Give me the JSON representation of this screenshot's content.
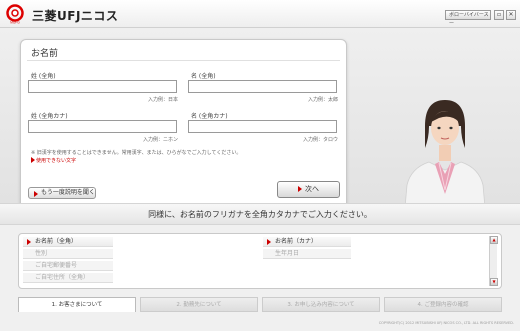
{
  "header": {
    "logo_text": "三菱UFJニコス",
    "lang_button": "ボローバイバースー",
    "win_buttons": [
      "▫",
      "✕"
    ]
  },
  "form": {
    "title": "お名前",
    "fields": [
      {
        "label": "姓 (全角)",
        "example": "入力例：日本"
      },
      {
        "label": "名 (全角)",
        "example": "入力例：太郎"
      },
      {
        "label": "姓 (全角カナ)",
        "example": "入力例：ニホン"
      },
      {
        "label": "名 (全角カナ)",
        "example": "入力例：タロウ"
      }
    ],
    "note": "※ 旧漢字を使用することはできません。常用漢字、または、ひらがなでご入力してください。",
    "note_link": "使用できない文字",
    "back_button": "もう一度説明を聞く",
    "next_button": "次へ"
  },
  "instruction": "同様に、お名前のフリガナを全角カタカナでご入力ください。",
  "progress_fields": {
    "left": [
      {
        "label": "お名前（全角）",
        "active": true
      },
      {
        "label": "性別",
        "active": false
      },
      {
        "label": "ご自宅郵便番号",
        "active": false
      },
      {
        "label": "ご自宅住所（全角）",
        "active": false
      }
    ],
    "right": [
      {
        "label": "お名前（カナ）",
        "active": true
      },
      {
        "label": "生年月日",
        "active": false
      }
    ]
  },
  "scroll_arrows": {
    "up": "▲",
    "down": "▼"
  },
  "tabs": [
    {
      "label": "1. お客さまについて",
      "active": true
    },
    {
      "label": "2. 勤務先について",
      "active": false
    },
    {
      "label": "3. お申し込み内容について",
      "active": false
    },
    {
      "label": "4. ご登録内容の確認",
      "active": false
    }
  ],
  "copyright": "COPYRIGHT(C) 2012 MITSUBISHI UFJ NICOS CO., LTD. ALL RIGHTS RESERVED.",
  "colors": {
    "accent": "#cc0000",
    "brand": "#cc0000"
  }
}
